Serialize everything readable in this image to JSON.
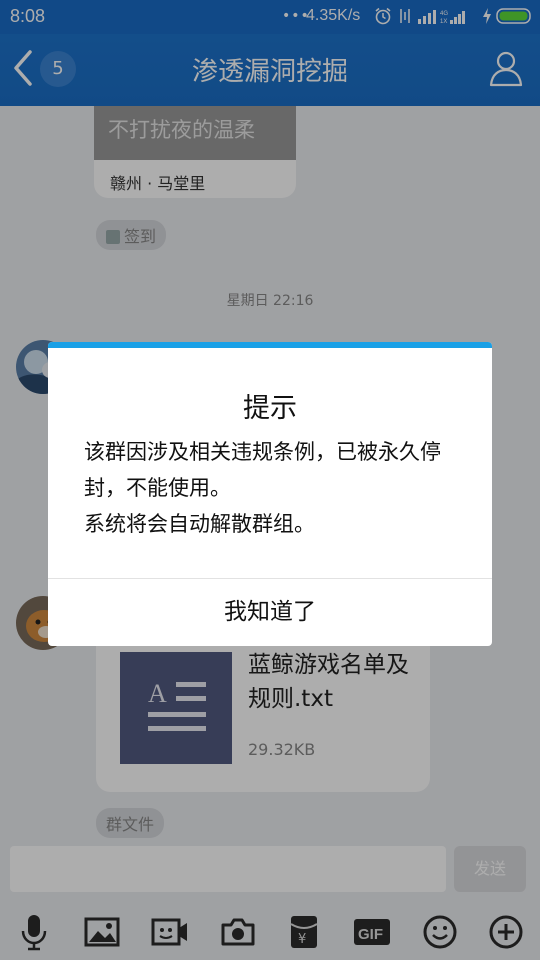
{
  "status": {
    "time": "8:08",
    "net_speed": "4.35K/s",
    "sim": "4G 1X"
  },
  "header": {
    "title": "渗透漏洞挖掘",
    "unread_badge": "5"
  },
  "chat": {
    "card": {
      "image_text": "不打扰夜的温柔",
      "location": "赣州 · 马堂里"
    },
    "signin_tag": "签到",
    "timestamp": "星期日 22:16",
    "file": {
      "name": "蓝鲸游戏名单及规则.txt",
      "size": "29.32KB"
    },
    "file_tag": "群文件"
  },
  "input": {
    "send_label": "发送"
  },
  "dialog": {
    "title": "提示",
    "message_line1": "该群因涉及相关违规条例，已被永久停封，不能使用。",
    "message_line2": "系统将会自动解散群组。",
    "button": "我知道了"
  },
  "toolbar": {
    "icons": [
      "mic-icon",
      "image-icon",
      "video-icon",
      "camera-icon",
      "red-packet-icon",
      "gif-icon",
      "emoji-icon",
      "plus-icon"
    ],
    "gif_label": "GIF"
  },
  "colors": {
    "header": "#1a6ec6",
    "dialog_accent": "#1aa0e6",
    "file_thumb": "#525a80"
  }
}
